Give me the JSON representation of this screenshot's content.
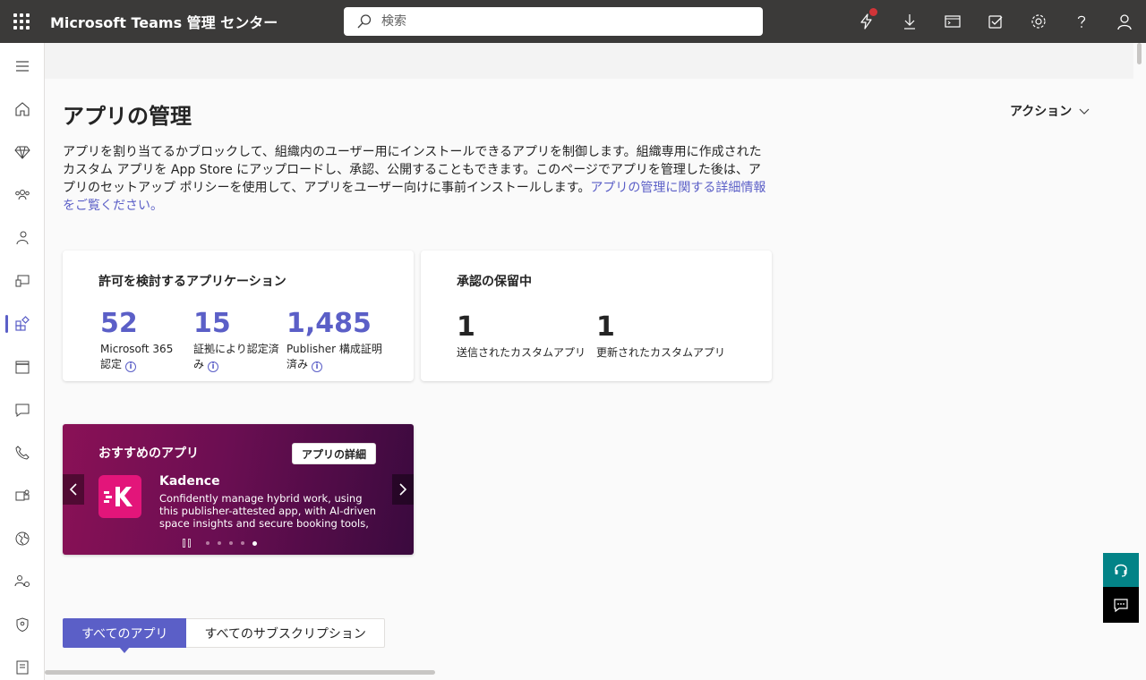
{
  "header": {
    "app_title": "Microsoft Teams 管理 センター",
    "search_placeholder": "検索"
  },
  "page": {
    "title": "アプリの管理",
    "actions_label": "アクション",
    "description": "アプリを割り当てるかブロックして、組織内のユーザー用にインストールできるアプリを制御します。組織専用に作成されたカスタム アプリを App Store にアップロードし、承認、公開することもできます。このページでアプリを管理した後は、アプリのセットアップ ポリシーを使用して、アプリをユーザー向けに事前インストールします。",
    "description_link": "アプリの管理に関する詳細情報をご覧ください。"
  },
  "permission_card": {
    "title": "許可を検討するアプリケーション",
    "stats": [
      {
        "value": "52",
        "label": "Microsoft 365 認定"
      },
      {
        "value": "15",
        "label": "証拠により認定済み"
      },
      {
        "value": "1,485",
        "label": "Publisher 構成証明済み"
      }
    ]
  },
  "pending_card": {
    "title": "承認の保留中",
    "stats": [
      {
        "value": "1",
        "label": "送信されたカスタムアプリ"
      },
      {
        "value": "1",
        "label": "更新されたカスタムアプリ"
      }
    ]
  },
  "featured": {
    "title": "おすすめのアプリ",
    "details_button": "アプリの詳細",
    "app_name": "Kadence",
    "app_description": "Confidently manage hybrid work, using this publisher-attested app, with AI-driven space insights and secure booking tools, all in one...",
    "slide_count": 5,
    "active_slide": 5
  },
  "tabs": [
    {
      "label": "すべてのアプリ",
      "active": true
    },
    {
      "label": "すべてのサブスクリプション",
      "active": false
    }
  ],
  "colors": {
    "accent": "#5b5fc7",
    "topbar": "#3b3a39",
    "banner": "#8a1156",
    "app_logo": "#e3157a",
    "help": "#038387",
    "notification": "#d13438"
  }
}
